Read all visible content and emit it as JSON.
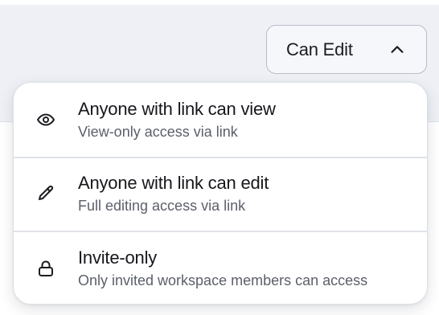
{
  "permission_select": {
    "current_value": "Can Edit",
    "chevron_icon": "chevron-up-icon",
    "expanded": true
  },
  "link_access_menu": {
    "items": [
      {
        "icon": "eye-icon",
        "title": "Anyone with link can view",
        "description": "View-only access via link"
      },
      {
        "icon": "pencil-icon",
        "title": "Anyone with link can edit",
        "description": "Full editing access via link"
      },
      {
        "icon": "lock-icon",
        "title": "Invite-only",
        "description": "Only invited workspace members can access"
      }
    ]
  },
  "colors": {
    "header_background": "#eef0f6",
    "menu_background": "#ffffff",
    "title_text": "#16171b",
    "description_text": "#5b5f69",
    "border": "#b9bdc8"
  }
}
